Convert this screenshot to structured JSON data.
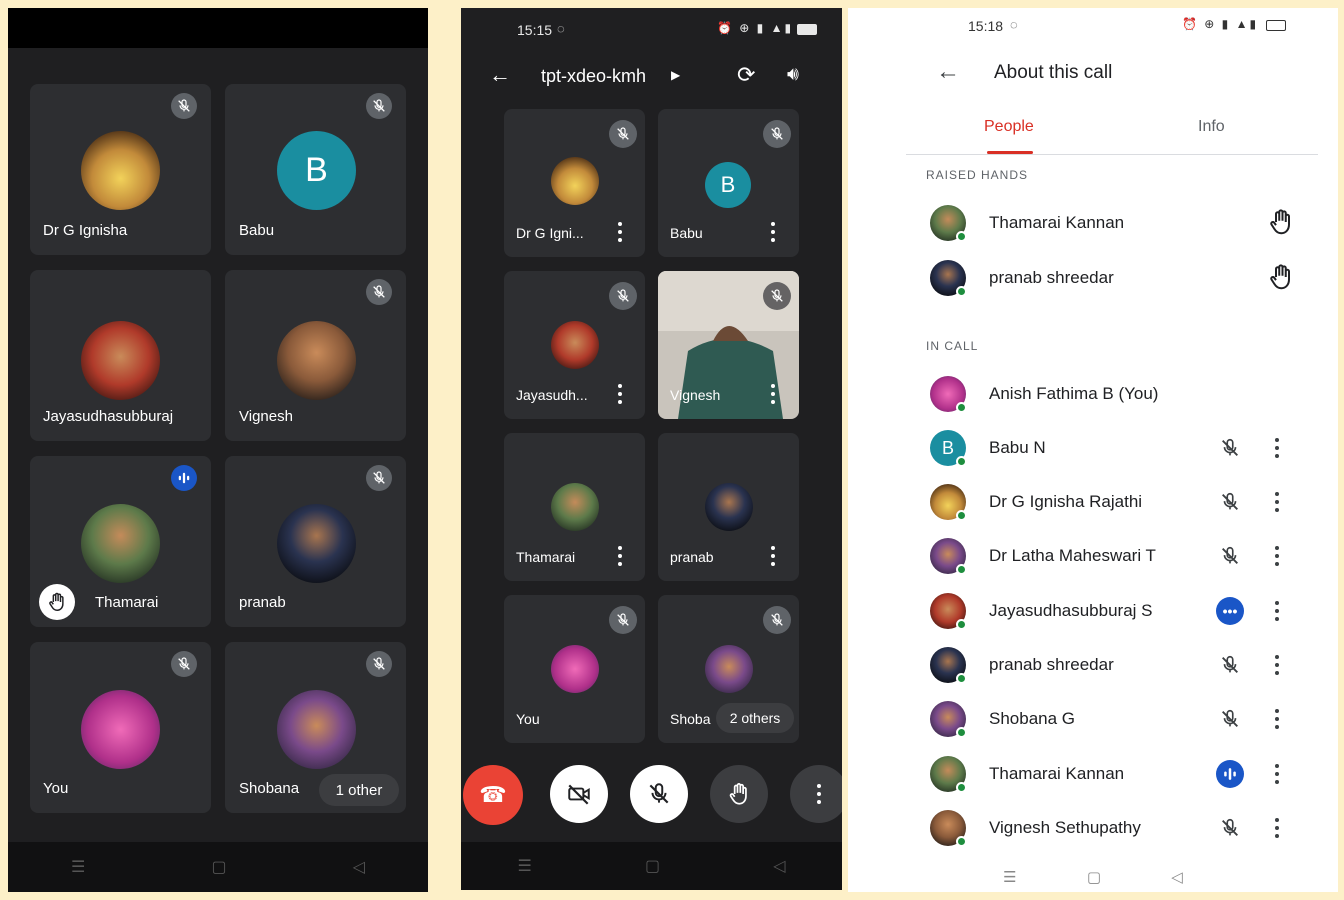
{
  "panel1": {
    "tiles": [
      {
        "name": "Dr G Ignisha"
      },
      {
        "name": "Babu",
        "initial": "B"
      },
      {
        "name": "Jayasudhasubburaj"
      },
      {
        "name": "Vignesh"
      },
      {
        "name": "Thamarai"
      },
      {
        "name": "pranab"
      },
      {
        "name": "You"
      },
      {
        "name": "Shobana"
      }
    ],
    "other_count": "1 other"
  },
  "panel2": {
    "status_time": "15:15",
    "meeting_code": "tpt-xdeo-kmh",
    "tiles": [
      {
        "name": "Dr G Igni..."
      },
      {
        "name": "Babu",
        "initial": "B"
      },
      {
        "name": "Jayasudh..."
      },
      {
        "name": "Vignesh"
      },
      {
        "name": "Thamarai"
      },
      {
        "name": "pranab"
      },
      {
        "name": "You"
      },
      {
        "name": "Shoba"
      }
    ],
    "others_count": "2 others"
  },
  "panel3": {
    "status_time": "15:18",
    "title": "About this call",
    "tabs": [
      "People",
      "Info"
    ],
    "raised_hands_label": "RAISED HANDS",
    "in_call_label": "IN CALL",
    "raised_hands": [
      {
        "name": "Thamarai Kannan"
      },
      {
        "name": "pranab shreedar"
      }
    ],
    "in_call": [
      {
        "name": "Anish Fathima B (You)",
        "status": "none"
      },
      {
        "name": "Babu N",
        "status": "muted",
        "initial": "B"
      },
      {
        "name": "Dr G Ignisha Rajathi",
        "status": "muted"
      },
      {
        "name": "Dr Latha Maheswari T",
        "status": "muted"
      },
      {
        "name": "Jayasudhasubburaj S",
        "status": "speaking-dots"
      },
      {
        "name": "pranab shreedar",
        "status": "muted"
      },
      {
        "name": "Shobana G",
        "status": "muted"
      },
      {
        "name": "Thamarai Kannan",
        "status": "speaking"
      },
      {
        "name": "Vignesh Sethupathy",
        "status": "muted"
      }
    ]
  },
  "colors": {
    "accent_red": "#d93025",
    "meet_blue": "#1a56c7",
    "tile_bg": "#2d2e31",
    "online_green": "#1e8e3e"
  }
}
